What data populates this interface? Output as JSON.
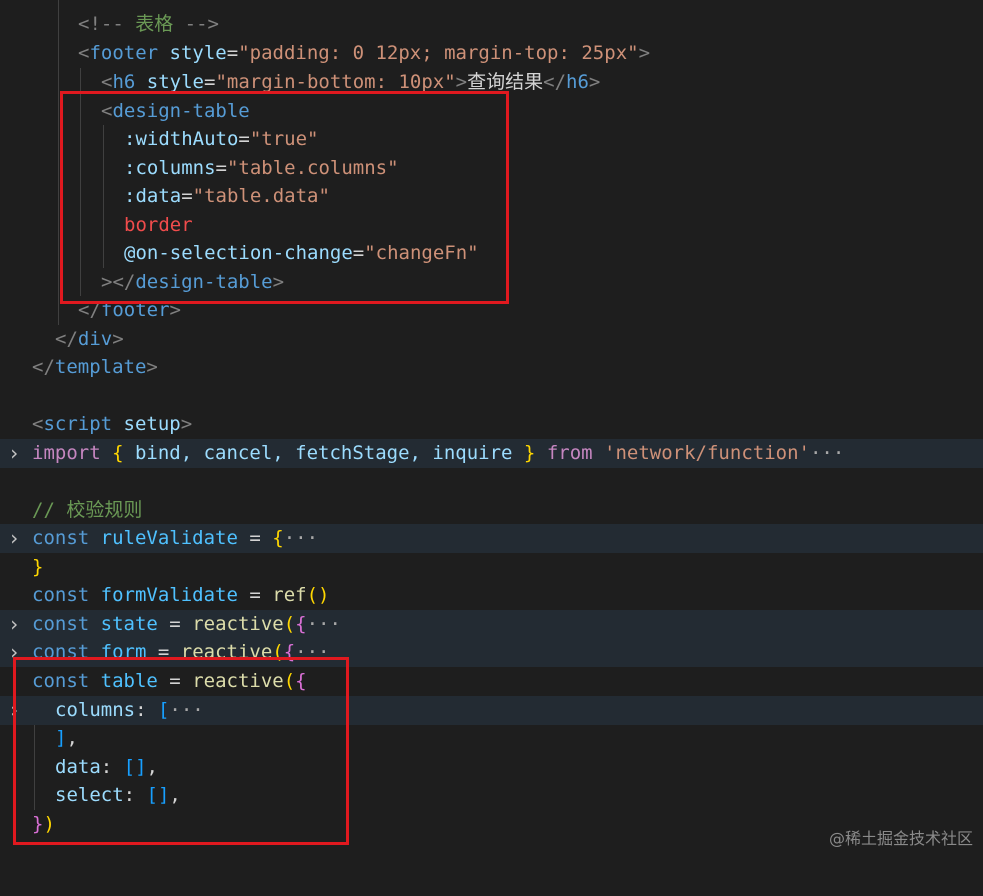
{
  "editor": {
    "lines": {
      "l1": {
        "open": "<!--",
        "text": " 表格 ",
        "close": "-->"
      },
      "l2": {
        "lt": "<",
        "tag": "footer",
        "sp": " ",
        "attr": "style",
        "eq": "=",
        "val": "\"padding: 0 12px; margin-top: 25px\"",
        "gt": ">"
      },
      "l3": {
        "lt": "<",
        "tag": "h6",
        "sp": " ",
        "attr": "style",
        "eq": "=",
        "val": "\"margin-bottom: 10px\"",
        "gt": ">",
        "text": "查询结果",
        "close_lt": "</",
        "close_tag": "h6",
        "close_gt": ">"
      },
      "l4": {
        "lt": "<",
        "tag": "design-table"
      },
      "l5": {
        "attr": ":widthAuto",
        "eq": "=",
        "val": "\"true\""
      },
      "l6": {
        "attr": ":columns",
        "eq": "=",
        "val": "\"table.columns\""
      },
      "l7": {
        "attr": ":data",
        "eq": "=",
        "val": "\"table.data\""
      },
      "l8": {
        "attr": "border"
      },
      "l9": {
        "attr": "@on-selection-change",
        "eq": "=",
        "val": "\"changeFn\""
      },
      "l10": {
        "gt": ">",
        "close_lt": "</",
        "tag": "design-table",
        "close_gt": ">"
      },
      "l11": {
        "lt": "</",
        "tag": "footer",
        "gt": ">"
      },
      "l12": {
        "lt": "</",
        "tag": "div",
        "gt": ">"
      },
      "l13": {
        "lt": "</",
        "tag": "template",
        "gt": ">"
      },
      "l15": {
        "lt": "<",
        "tag": "script",
        "sp": " ",
        "attr": "setup",
        "gt": ">"
      },
      "l16": {
        "kw": "import",
        "sp": " ",
        "ob": "{",
        "names": " bind, cancel, fetchStage, inquire ",
        "cb": "}",
        "sp2": " ",
        "from": "from",
        "sp3": " ",
        "str": "'network/function'",
        "ell": "···"
      },
      "l18": {
        "comment": "// 校验规则"
      },
      "l19": {
        "kw": "const",
        "sp": " ",
        "name": "ruleValidate",
        "op": " = ",
        "ob": "{",
        "ell": "···"
      },
      "l20": {
        "cb": "}"
      },
      "l21": {
        "kw": "const",
        "sp": " ",
        "name": "formValidate",
        "op": " = ",
        "fn": "ref",
        "par": "()"
      },
      "l22": {
        "kw": "const",
        "sp": " ",
        "name": "state",
        "op": " = ",
        "fn": "reactive",
        "op2": "(",
        "ob": "{",
        "ell": "···"
      },
      "l23": {
        "kw": "const",
        "sp": " ",
        "name": "form",
        "op": " = ",
        "fn": "reactive",
        "op2": "(",
        "ob": "{",
        "ell": "···"
      },
      "l24": {
        "kw": "const",
        "sp": " ",
        "name": "table",
        "op": " = ",
        "fn": "reactive",
        "op2": "(",
        "ob": "{"
      },
      "l25": {
        "prop": "columns",
        "colon": ": ",
        "ob": "[",
        "ell": "···"
      },
      "l26": {
        "cb": "]",
        "comma": ","
      },
      "l27": {
        "prop": "data",
        "colon": ": ",
        "arr": "[]",
        "comma": ","
      },
      "l28": {
        "prop": "select",
        "colon": ": ",
        "arr": "[]",
        "comma": ","
      },
      "l29": {
        "cb": "}",
        "cp": ")"
      }
    },
    "fold_icon": "chevron-right-icon"
  },
  "highlight_color": "#e0191f",
  "watermark": "@稀土掘金技术社区"
}
